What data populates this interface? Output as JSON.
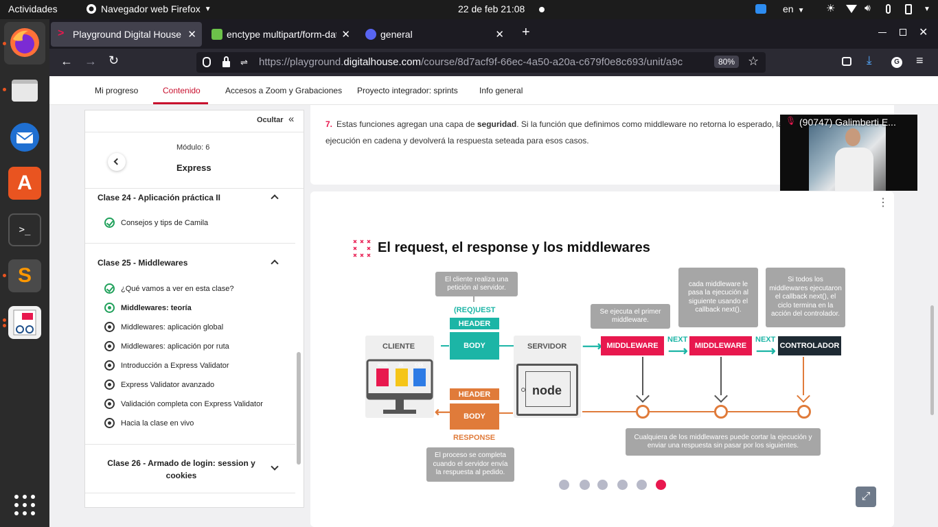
{
  "topbar": {
    "activities": "Actividades",
    "app_name": "Navegador web Firefox",
    "datetime": "22 de feb  21:08",
    "lang": "en"
  },
  "browser": {
    "tabs": [
      {
        "label": "Playground Digital House"
      },
      {
        "label": "enctype multipart/form-data"
      },
      {
        "label": "general"
      }
    ],
    "url_prefix": "https://playground.",
    "url_domain": "digitalhouse.com",
    "url_rest": "/course/8d7acf9f-66ec-4a50-a20a-c679f0e8c693/unit/a9c",
    "zoom": "80%"
  },
  "page_tabs": [
    "Mi progreso",
    "Contenido",
    "Accesos a Zoom y Grabaciones",
    "Proyecto integrador: sprints",
    "Info general"
  ],
  "sidebar": {
    "hide_label": "Ocultar",
    "module_label": "Módulo:",
    "module_number": "6",
    "module_name": "Express",
    "clase24_title": "Clase 24 - Aplicación práctica II",
    "clase24_items": [
      "Consejos y tips de Camila"
    ],
    "clase25_title": "Clase 25 - Middlewares",
    "clase25_items": [
      "¿Qué vamos a ver en esta clase?",
      "Middlewares: teoría",
      "Middlewares: aplicación global",
      "Middlewares: aplicación por ruta",
      "Introducción a Express Validator",
      "Express Validator avanzado",
      "Validación completa con Express Validator",
      "Hacia la clase en vivo"
    ],
    "clase26_title": "Clase 26 - Armado de login: session y cookies"
  },
  "main": {
    "step_number": "7.",
    "step_text_1": "Estas funciones agregan una capa de ",
    "step_text_bold": "seguridad",
    "step_text_2": ". Si la función que definimos como middleware no retorna lo esperado, la",
    "step_text_3": "ejecución en cadena y devolverá la respuesta seteada para esos casos.",
    "video_caption": "(90747) Galimberti E..."
  },
  "diagram": {
    "title": "El request, el response y los middlewares",
    "client_label": "CLIENTE",
    "server_label": "SERVIDOR",
    "request_label": "(REQ)UEST",
    "response_label": "RESPONSE",
    "header": "HEADER",
    "body": "BODY",
    "middleware": "MIDDLEWARE",
    "next": "NEXT",
    "controller": "CONTROLADOR",
    "node_text": "node",
    "html_label": "HTML",
    "js_label": "JS",
    "css_label": "CSS",
    "bubble_client": "El cliente realiza una petición al servidor.",
    "bubble_first_mw": "Se ejecuta el primer middleware.",
    "bubble_next": "cada middleware le pasa la ejecución al siguiente usando el callback next().",
    "bubble_controller": "Si todos los middlewares ejecutaron el callback next(), el ciclo termina en la acción del controlador.",
    "bubble_cut": "Cualquiera de los middlewares puede cortar la ejecución y enviar una respuesta sin pasar por los siguientes.",
    "bubble_response": "El proceso se completa cuando el servidor envía la respuesta al pedido."
  },
  "carousel": {
    "total": 6,
    "active": 6
  },
  "colors": {
    "teal": "#1cb5a6",
    "crimson": "#e8184e",
    "orange": "#e07b3a",
    "dark": "#1e2a33",
    "gray": "#6b6b6b"
  }
}
